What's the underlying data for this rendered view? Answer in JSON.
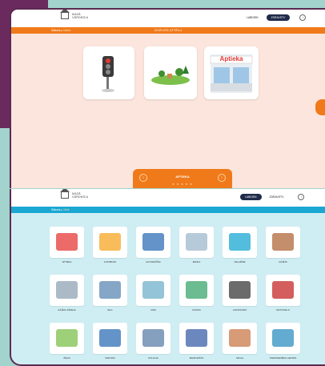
{
  "app": {
    "logo_line1": "MAZĀ",
    "logo_line2": "VĀRDNĪCA"
  },
  "languages": [
    "LABDIEN",
    "ZDRAVSTV"
  ],
  "screen1": {
    "breadcrumb_home": "Sākums",
    "breadcrumb_current": "Atklāts",
    "title": "IZVĒLIES ATTĒLU",
    "options": [
      {
        "name": "traffic-light",
        "text": ""
      },
      {
        "name": "field-trees",
        "text": ""
      },
      {
        "name": "aptieka-sign",
        "text": "Aptieka"
      }
    ],
    "bottom_label": "APTIEKA",
    "page_dots": "● ● ● ● ●"
  },
  "screen2": {
    "breadcrumb_home": "Sākums",
    "breadcrumb_current": "Vārdi",
    "items": [
      "APTIEKA",
      "AUTOBUSS",
      "AUTOMAŠĪNA",
      "BANKA",
      "CEĻAZĪME",
      "GĀJĒJS",
      "GĀJĒJU PĀREJA",
      "IELA",
      "KINO",
      "KIOSKS",
      "LUKSOFORS",
      "MOTOCIKLS",
      "ĀRAIS",
      "PIETURA",
      "POLICIJA",
      "BANKOMĀTS",
      "SKOLA",
      "TIRDZNIECĪBAS CENTRS"
    ]
  },
  "colors": {
    "orange": "#f07a1a",
    "blue": "#1aa7d2",
    "purple": "#6a2a5e"
  }
}
